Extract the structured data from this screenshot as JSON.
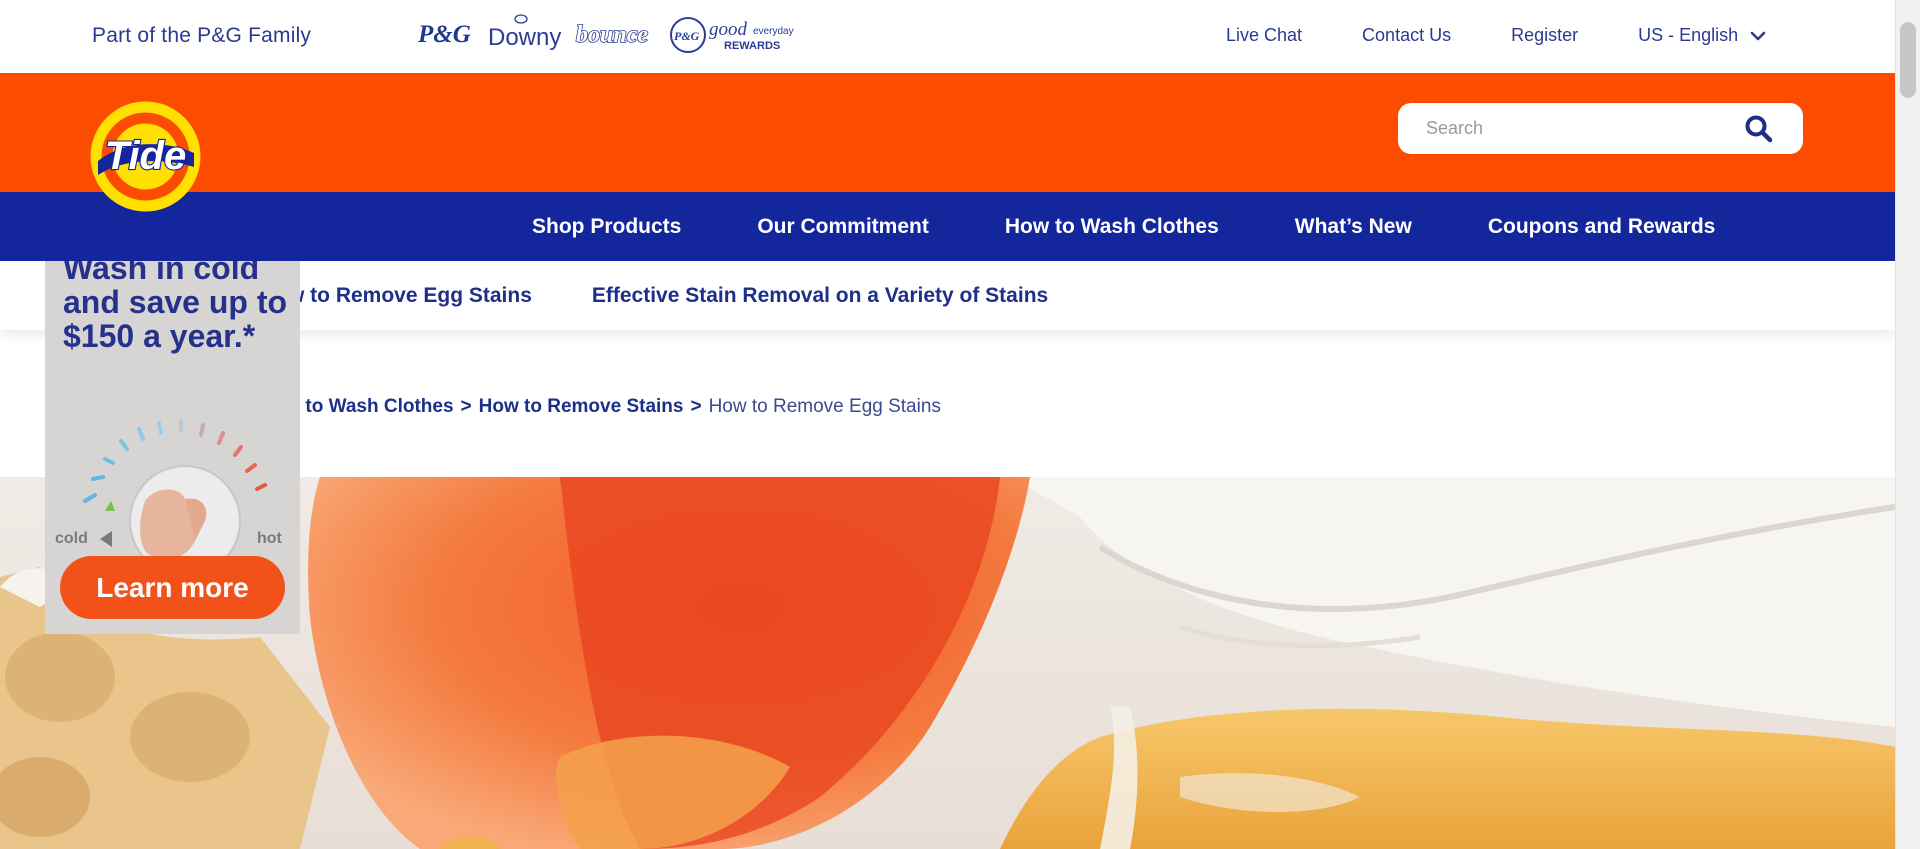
{
  "utility": {
    "family_text": "Part of the P&G Family",
    "brand_logos": [
      "P&G",
      "Downy",
      "bounce",
      "P&G good everyday REWARDS"
    ],
    "links": [
      "Live Chat",
      "Contact Us",
      "Register"
    ],
    "language": "US - English"
  },
  "header": {
    "logo_text": "Tide",
    "search_placeholder": "Search"
  },
  "nav": {
    "items": [
      "Shop Products",
      "Our Commitment",
      "How to Wash Clothes",
      "What’s New",
      "Coupons and Rewards"
    ]
  },
  "subnav": {
    "items": [
      "How to Remove Egg Stains",
      "Effective Stain Removal on a Variety of Stains"
    ]
  },
  "breadcrumb": {
    "items": [
      "How to Wash Clothes",
      "How to Remove Stains"
    ],
    "separator": ">",
    "current": "How to Remove Egg Stains"
  },
  "ad": {
    "headline": "Wash in cold and save up to $150 a year.*",
    "dial_cold": "cold",
    "dial_hot": "hot",
    "cta": "Learn more"
  },
  "colors": {
    "orange": "#fc4c02",
    "navy": "#14269c",
    "link_blue": "#2b3a8f"
  }
}
